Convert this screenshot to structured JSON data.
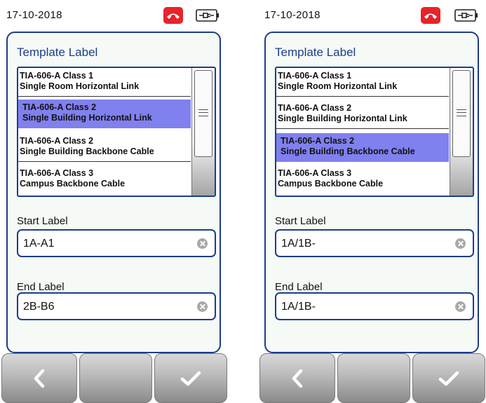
{
  "screens": [
    {
      "date": "17-10-2018",
      "title": "Template Label",
      "items": [
        {
          "line1": "TIA-606-A Class 1",
          "line2": "Single Room Horizontal Link"
        },
        {
          "line1": "TIA-606-A Class 2",
          "line2": "Single Building Horizontal Link"
        },
        {
          "line1": "TIA-606-A Class 2",
          "line2": "Single Building Backbone Cable"
        },
        {
          "line1": "TIA-606-A Class 3",
          "line2": "Campus Backbone Cable"
        }
      ],
      "selected_index": 1,
      "start_label": "Start Label",
      "start_value": "1A-A1",
      "end_label": "End Label",
      "end_value": "2B-B6"
    },
    {
      "date": "17-10-2018",
      "title": "Template Label",
      "items": [
        {
          "line1": "TIA-606-A Class 1",
          "line2": "Single Room Horizontal Link"
        },
        {
          "line1": "TIA-606-A Class 2",
          "line2": "Single Building Horizontal Link"
        },
        {
          "line1": "TIA-606-A Class 2",
          "line2": "Single Building Backbone Cable"
        },
        {
          "line1": "TIA-606-A Class 3",
          "line2": "Campus Backbone Cable"
        }
      ],
      "selected_index": 2,
      "start_label": "Start Label",
      "start_value": "1A/1B-",
      "end_label": "End Label",
      "end_value": "1A/1B-"
    }
  ],
  "colors": {
    "accent": "#1c3c8c",
    "selection": "#8080ee",
    "alert": "#e8232a"
  },
  "icons": [
    "phone-hangup-icon",
    "battery-plug-icon",
    "clear-icon",
    "back-icon",
    "checkmark-icon"
  ]
}
